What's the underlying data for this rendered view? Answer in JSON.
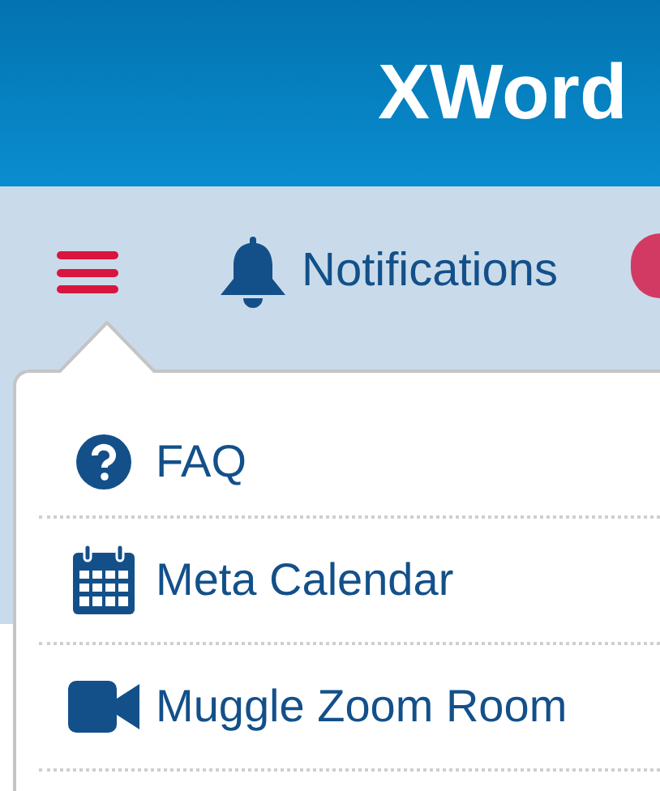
{
  "header": {
    "title": "XWord"
  },
  "nav": {
    "notifications": "Notifications",
    "menu_open": true
  },
  "menu": [
    {
      "label": "FAQ"
    },
    {
      "label": "Meta Calendar"
    },
    {
      "label": "Muggle Zoom Room"
    }
  ]
}
